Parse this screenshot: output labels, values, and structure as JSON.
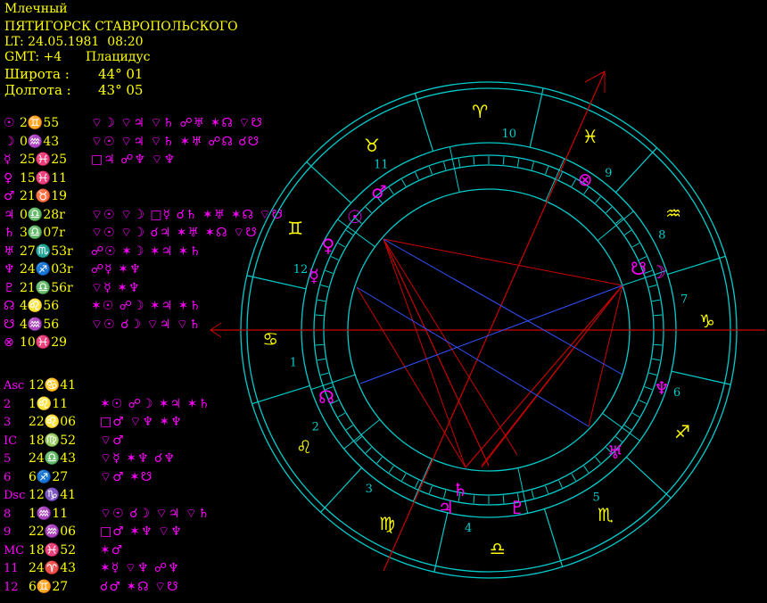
{
  "header": {
    "name": "Млечный",
    "place": "ПЯТИГОРСК СТАВРОПОЛЬСКОГО",
    "lt": "LT: 24.05.1981  08:20",
    "gmt": "GMT: +4",
    "system": "Плацидус",
    "lat_label": "Широта :",
    "lat_value": "44° 01",
    "lon_label": "Долгота :",
    "lon_value": "43° 05"
  },
  "planets": [
    {
      "glyph": "☉",
      "pos": "2♊55",
      "aspects": "⌔☽ ⌔♃ ⌔♄ ☍♅ ✶☊ ⌔☋"
    },
    {
      "glyph": "☽",
      "pos": "0♒43",
      "aspects": "⌔☉ ⌔♃ ⌔♄ ✶♅ ☍☊ ☌☋"
    },
    {
      "glyph": "☿",
      "pos": "25♓25",
      "aspects": "□♃ ☍♆ ⌔♆"
    },
    {
      "glyph": "♀",
      "pos": "15♓11",
      "aspects": ""
    },
    {
      "glyph": "♂",
      "pos": "21♉19",
      "aspects": ""
    },
    {
      "glyph": "♃",
      "pos": "0♎28r",
      "aspects": "⌔☉ ⌔☽ □☿ ☌♄ ✶♅ ✶☊ ⌔☋"
    },
    {
      "glyph": "♄",
      "pos": "3♎07r",
      "aspects": "⌔☉ ⌔☽ ☌♃ ✶♅ ✶☊ ⌔☋"
    },
    {
      "glyph": "♅",
      "pos": "27♏53r",
      "aspects": "☍☉ ✶☽ ✶♃ ✶♄"
    },
    {
      "glyph": "♆",
      "pos": "24♐03r",
      "aspects": "☍☿ ✶♆"
    },
    {
      "glyph": "♇",
      "pos": "21♎56r",
      "aspects": "⌔☿ ✶♆"
    },
    {
      "glyph": "☊",
      "pos": "4♌56",
      "aspects": "✶☉ ☍☽ ✶♃ ✶♄"
    },
    {
      "glyph": "☋",
      "pos": "4♒56",
      "aspects": "⌔☉ ☌☽ ⌔♃ ⌔♄"
    },
    {
      "glyph": "⊗",
      "pos": "10♓29",
      "aspects": ""
    }
  ],
  "houses": [
    {
      "label": "Asc",
      "pos": "12♋41",
      "aspects": ""
    },
    {
      "label": "2",
      "pos": "1♌11",
      "aspects": "✶☉ ☍☽ ✶♃ ✶♄"
    },
    {
      "label": "3",
      "pos": "22♌06",
      "aspects": "□♂ ⌔♆ ✶♆"
    },
    {
      "label": "IC",
      "pos": "18♍52",
      "aspects": "⌔♂"
    },
    {
      "label": "5",
      "pos": "24♎43",
      "aspects": "⌔☿ ✶♆ ☌♆"
    },
    {
      "label": "6",
      "pos": "6♐27",
      "aspects": "⌔♂ ✶☋"
    },
    {
      "label": "Dsc",
      "pos": "12♑41",
      "aspects": ""
    },
    {
      "label": "8",
      "pos": "1♒11",
      "aspects": "⌔☉ ☌☽ ⌔♃ ⌔♄"
    },
    {
      "label": "9",
      "pos": "22♒06",
      "aspects": "□♂ ✶♆ ⌔♆"
    },
    {
      "label": "MC",
      "pos": "18♓52",
      "aspects": "✶♂"
    },
    {
      "label": "11",
      "pos": "24♈43",
      "aspects": "✶☿ ⌔♆ ☍♆"
    },
    {
      "label": "12",
      "pos": "6♊27",
      "aspects": "☌♂ ✶☊ ⌔☋"
    }
  ],
  "wheel": {
    "house_numbers": [
      "1",
      "2",
      "3",
      "4",
      "5",
      "6",
      "7",
      "8",
      "9",
      "10",
      "11",
      "12"
    ],
    "zodiac": [
      "♈",
      "♉",
      "♊",
      "♋",
      "♌",
      "♍",
      "♎",
      "♏",
      "♐",
      "♑",
      "♒",
      "♓"
    ],
    "colors": {
      "ring": "#00cccc",
      "sign": "#ffff00",
      "planet": "#ff00ff",
      "axis": "#cc0000",
      "aspect_red": "#cc0000",
      "aspect_blue": "#3050ff",
      "house_num": "#00cccc"
    }
  }
}
